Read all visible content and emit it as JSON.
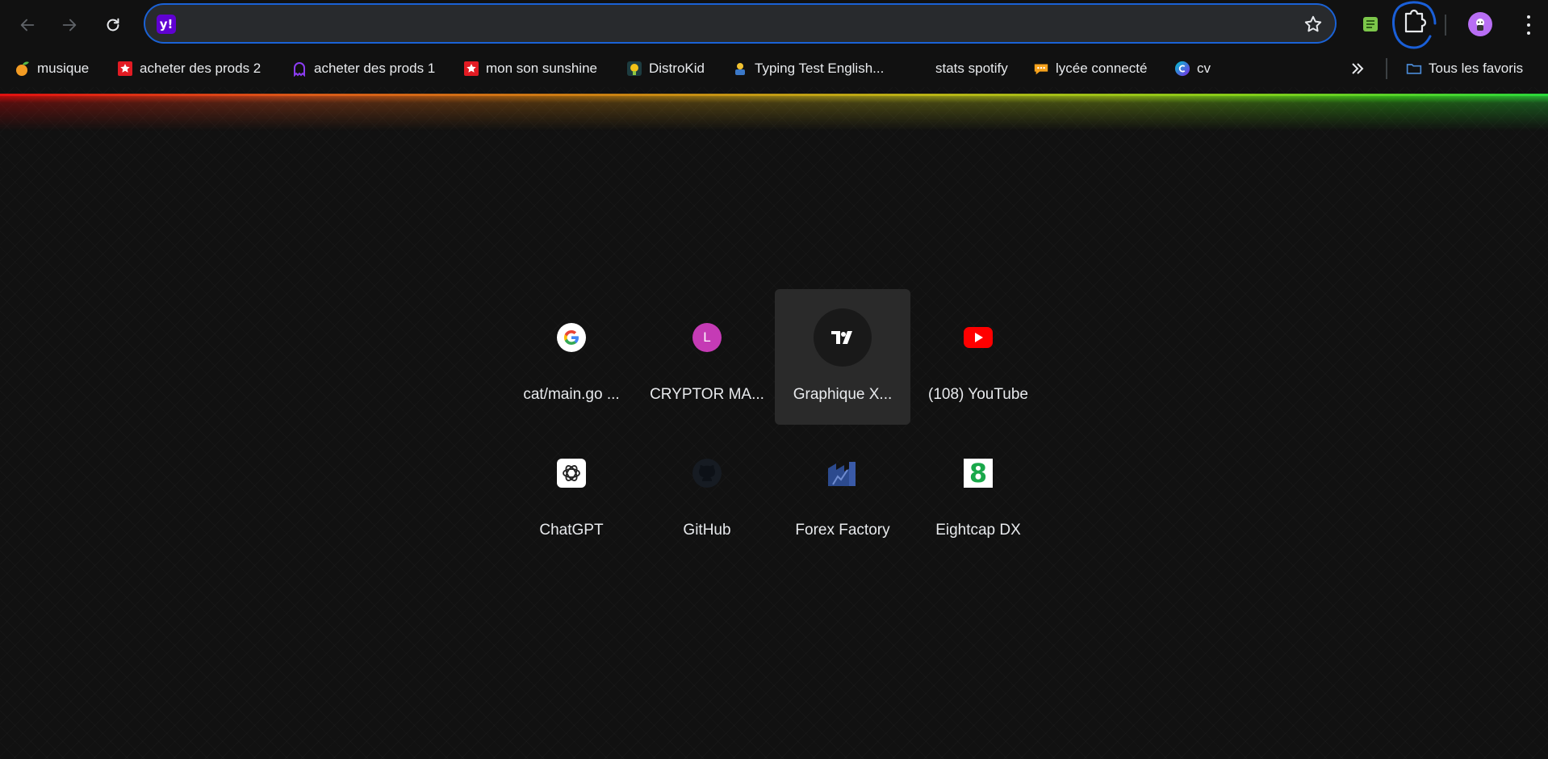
{
  "omnibox": {
    "value": "",
    "placeholder": ""
  },
  "toolbar": {
    "back_icon": "arrow-left-icon",
    "forward_icon": "arrow-right-icon",
    "reload_icon": "reload-icon",
    "star_icon": "star-outline-icon",
    "extensions_icon": "puzzle-icon",
    "menu_icon": "kebab-menu-icon"
  },
  "bookmarks": [
    {
      "label": "musique",
      "icon": "orange-fruit-icon"
    },
    {
      "label": "acheter des prods 2",
      "icon": "red-star-logo-icon"
    },
    {
      "label": "acheter des prods 1",
      "icon": "purple-ghost-icon"
    },
    {
      "label": "mon son sunshine",
      "icon": "red-star-logo-icon"
    },
    {
      "label": "DistroKid",
      "icon": "distrokid-icon"
    },
    {
      "label": "Typing Test English...",
      "icon": "typing-test-icon"
    },
    {
      "label": "stats spotify",
      "icon": ""
    },
    {
      "label": "lycée connecté",
      "icon": "chat-bubble-icon"
    },
    {
      "label": "cv",
      "icon": "canva-icon"
    }
  ],
  "bookmarks_overflow_icon": "double-chevron-right-icon",
  "all_favorites": {
    "label": "Tous les favoris",
    "icon": "folder-icon"
  },
  "shortcuts": [
    {
      "label": "cat/main.go ...",
      "icon": "google-g-icon"
    },
    {
      "label": "CRYPTOR MA...",
      "icon": "letter-avatar-icon",
      "letter": "L",
      "color": "#c53bb5"
    },
    {
      "label": "Graphique X...",
      "icon": "tradingview-icon"
    },
    {
      "label": "(108) YouTube",
      "icon": "youtube-icon"
    },
    {
      "label": "ChatGPT",
      "icon": "chatgpt-icon"
    },
    {
      "label": "GitHub",
      "icon": "github-icon"
    },
    {
      "label": "Forex Factory",
      "icon": "forex-factory-icon"
    },
    {
      "label": "Eightcap DX",
      "icon": "eightcap-icon",
      "letter": "8"
    }
  ],
  "colors": {
    "accent": "#1a62d6",
    "yahoo": "#6001d2"
  },
  "yahoo_mark": "y!"
}
